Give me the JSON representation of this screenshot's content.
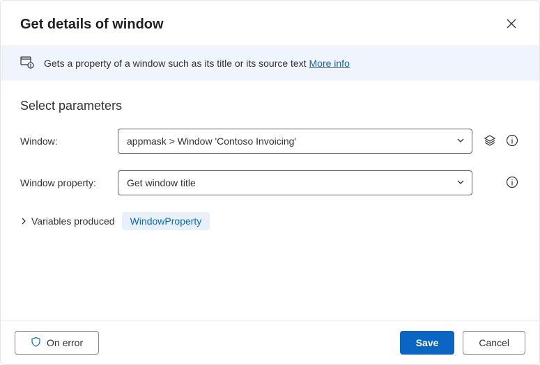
{
  "header": {
    "title": "Get details of window"
  },
  "info": {
    "text": "Gets a property of a window such as its title or its source text ",
    "link": "More info"
  },
  "section": {
    "title": "Select parameters"
  },
  "fields": {
    "window": {
      "label": "Window:",
      "value": "appmask > Window 'Contoso Invoicing'"
    },
    "property": {
      "label": "Window property:",
      "value": "Get window title"
    }
  },
  "variables": {
    "label": "Variables produced",
    "chip": "WindowProperty"
  },
  "footer": {
    "onError": "On error",
    "save": "Save",
    "cancel": "Cancel"
  }
}
